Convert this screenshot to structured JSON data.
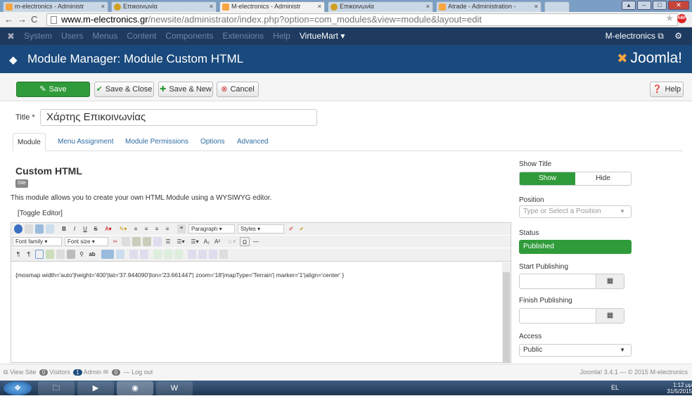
{
  "browser": {
    "tabs": [
      {
        "title": "m-electronics - Administr",
        "active": false
      },
      {
        "title": "Επικοινωνία",
        "active": false
      },
      {
        "title": "M-electronics - Administr",
        "active": true
      },
      {
        "title": "Επικοινωνία",
        "active": false
      },
      {
        "title": "Atrade - Administration -",
        "active": false
      }
    ],
    "url_domain": "www.m-electronics.gr",
    "url_path": "/newsite/administrator/index.php?option=com_modules&view=module&layout=edit",
    "abp_label": "ABP"
  },
  "topnav": {
    "items": [
      "System",
      "Users",
      "Menus",
      "Content",
      "Components",
      "Extensions",
      "Help"
    ],
    "virtuemart": "VirtueMart ▾",
    "site_link": "M-electronics ⧉",
    "settings_icon": "gear-icon"
  },
  "header": {
    "title": "Module Manager: Module Custom HTML",
    "brand": "Joomla!"
  },
  "toolbar": {
    "save": "Save",
    "save_close": "Save & Close",
    "save_new": "Save & New",
    "cancel": "Cancel",
    "help": "Help"
  },
  "form": {
    "title_label": "Title *",
    "title_value": "Χάρτης Επικοινωνίας",
    "tabs": [
      "Module",
      "Menu Assignment",
      "Module Permissions",
      "Options",
      "Advanced"
    ],
    "heading": "Custom HTML",
    "badge": "Site",
    "description": "This module allows you to create your own HTML Module using a WYSIWYG editor.",
    "toggle_editor": "[Toggle Editor]",
    "format_select": "Paragraph",
    "styles_select": "Styles",
    "fontfamily_select": "Font family",
    "fontsize_select": "Font size",
    "editor_content": "{mosmap width='auto'|height='400'|lat='37.944090'|lon='23.661447'| zoom='18'|mapType='Terrain'| marker='1'|align='center' }"
  },
  "sidebar": {
    "show_title_label": "Show Title",
    "show": "Show",
    "hide": "Hide",
    "position_label": "Position",
    "position_placeholder": "Type or Select a Position",
    "status_label": "Status",
    "status_value": "Published",
    "start_publishing_label": "Start Publishing",
    "finish_publishing_label": "Finish Publishing",
    "access_label": "Access",
    "access_value": "Public"
  },
  "statusbar": {
    "view_site": "View Site",
    "visitors_count": "0",
    "visitors_label": "Visitors",
    "admin_count": "1",
    "admin_label": "Admin",
    "messages_count": "0",
    "logout": "Log out",
    "version": "Joomla! 3.4.1 — © 2015 M-electronics"
  },
  "taskbar": {
    "lang": "EL",
    "time": "1:12 μμ",
    "date": "31/5/2015"
  },
  "colors": {
    "navbar": "#1e3a5f",
    "header": "#1a4a7d",
    "green": "#2f9b3a",
    "joomla_orange": "#f9a541"
  }
}
